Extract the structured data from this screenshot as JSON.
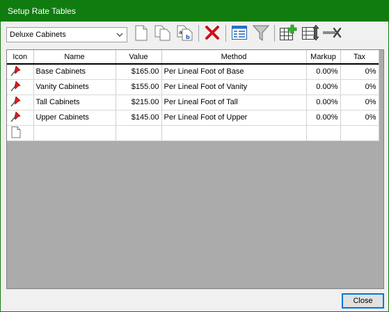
{
  "window": {
    "title": "Setup Rate Tables"
  },
  "toolbar": {
    "table_select": {
      "value": "Deluxe Cabinets"
    },
    "buttons": [
      {
        "name": "new-button"
      },
      {
        "name": "copy-button"
      },
      {
        "name": "rename-button"
      },
      {
        "name": "delete-button"
      },
      {
        "name": "edit-button"
      },
      {
        "name": "filter-button"
      },
      {
        "name": "add-table-button"
      },
      {
        "name": "sort-button"
      },
      {
        "name": "remove-button"
      }
    ]
  },
  "grid": {
    "columns": [
      "Icon",
      "Name",
      "Value",
      "Method",
      "Markup",
      "Tax"
    ],
    "rows": [
      {
        "icon": "pin-icon",
        "name": "Base Cabinets",
        "value": "$165.00",
        "method": "Per Lineal Foot of Base",
        "markup": "0.00%",
        "tax": "0%"
      },
      {
        "icon": "pin-icon",
        "name": "Vanity Cabinets",
        "value": "$155.00",
        "method": "Per Lineal Foot of Vanity",
        "markup": "0.00%",
        "tax": "0%"
      },
      {
        "icon": "pin-icon",
        "name": "Tall Cabinets",
        "value": "$215.00",
        "method": "Per Lineal Foot of Tall",
        "markup": "0.00%",
        "tax": "0%"
      },
      {
        "icon": "pin-icon",
        "name": "Upper Cabinets",
        "value": "$145.00",
        "method": "Per Lineal Foot of Upper",
        "markup": "0.00%",
        "tax": "0%"
      },
      {
        "icon": "new-row-icon",
        "name": "",
        "value": "",
        "method": "",
        "markup": "",
        "tax": ""
      }
    ]
  },
  "footer": {
    "close_label": "Close"
  },
  "colors": {
    "titlebar": "#107c10",
    "grid_background": "#ababab",
    "pin": "#d81e1e"
  }
}
